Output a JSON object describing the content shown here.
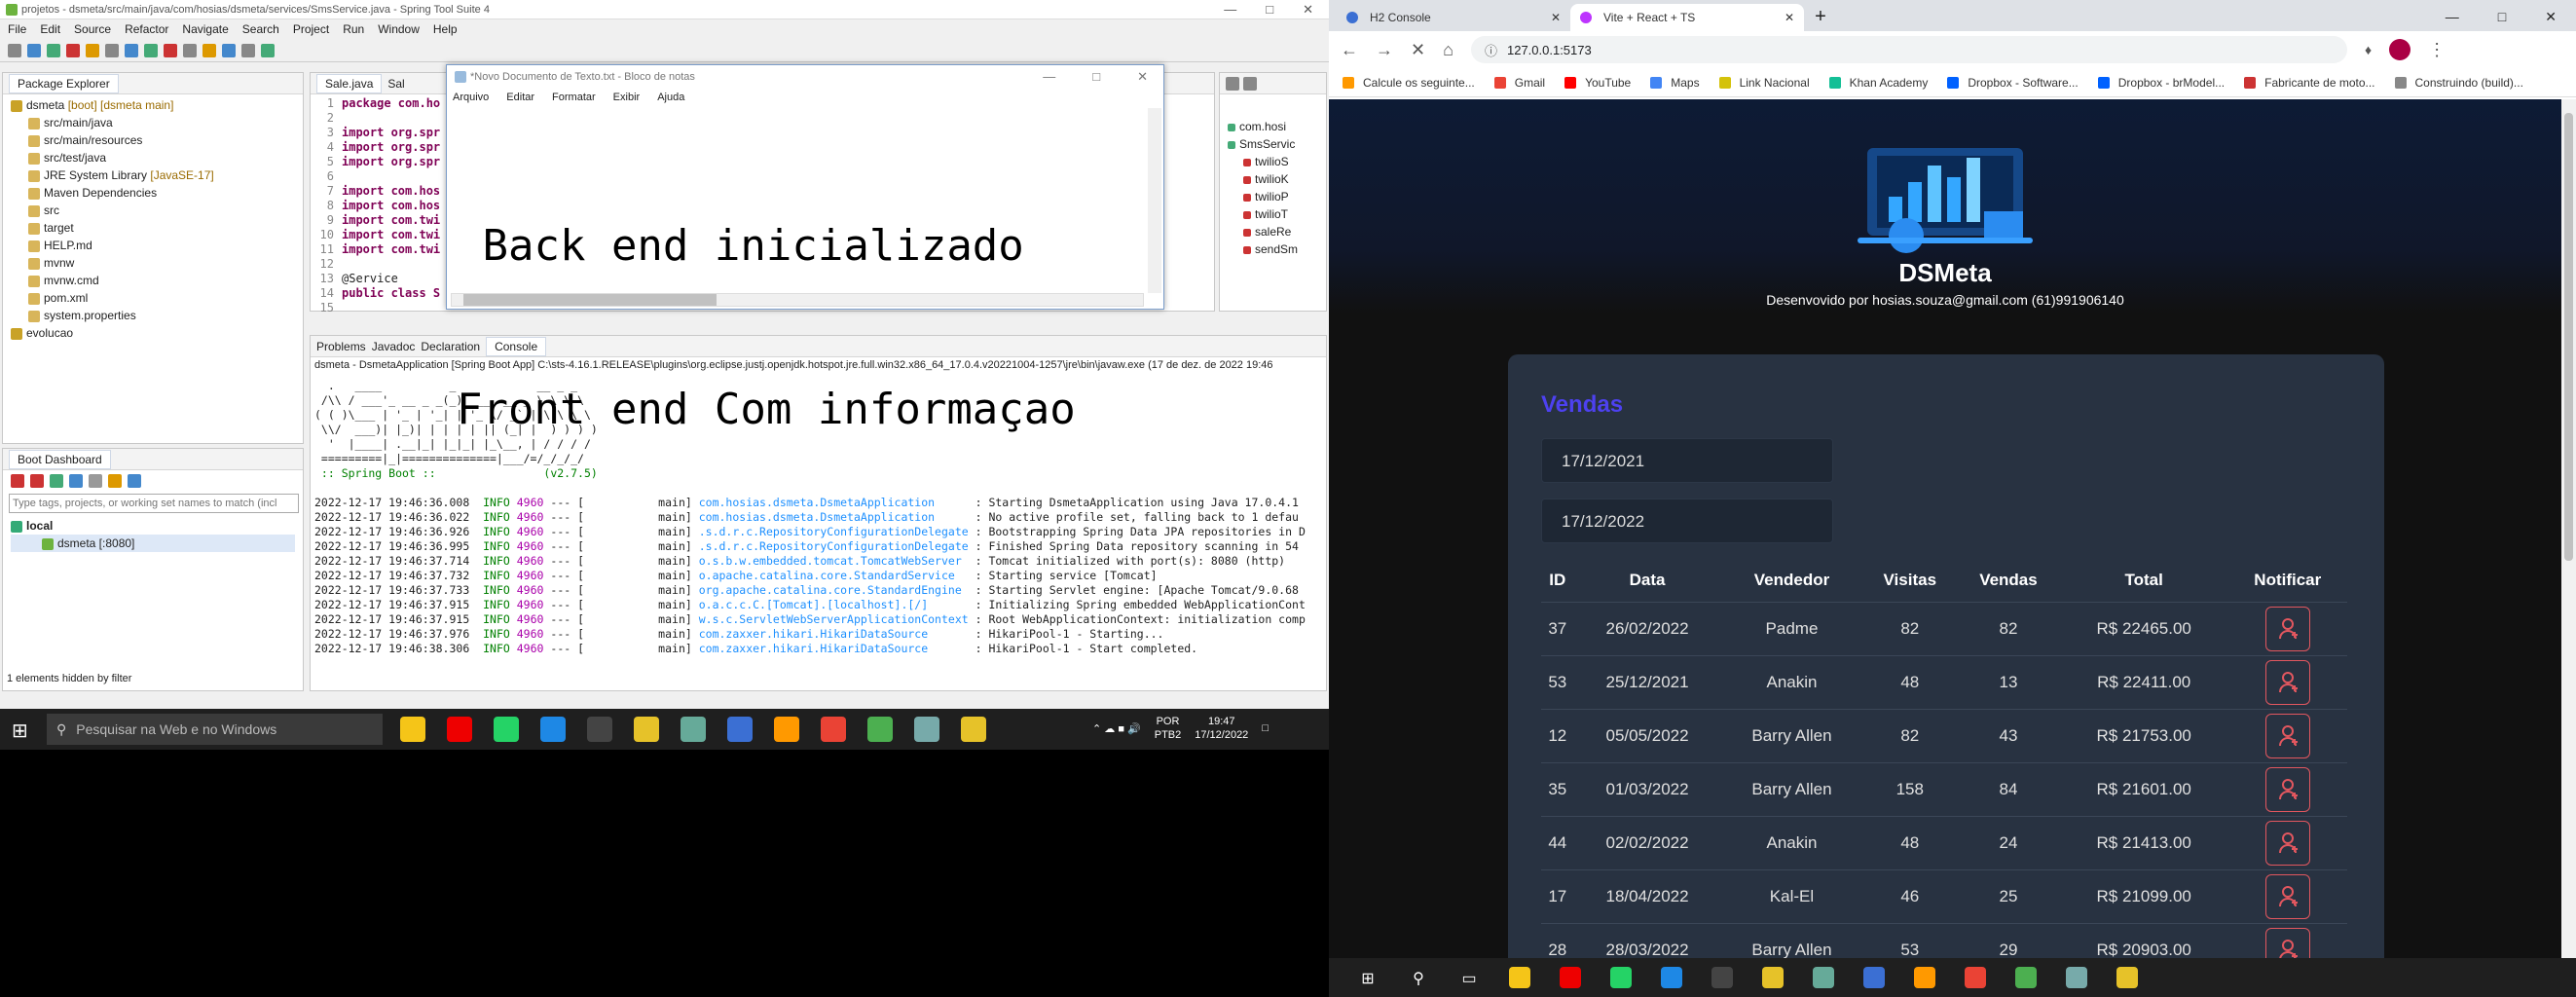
{
  "ide": {
    "title": "projetos - dsmeta/src/main/java/com/hosias/dsmeta/services/SmsService.java - Spring Tool Suite 4",
    "menu": [
      "File",
      "Edit",
      "Source",
      "Refactor",
      "Navigate",
      "Search",
      "Project",
      "Run",
      "Window",
      "Help"
    ],
    "package_explorer": {
      "tab": "Package Explorer",
      "items": [
        {
          "label": "dsmeta",
          "extra": " [boot] [dsmeta main]",
          "level": 0
        },
        {
          "label": "src/main/java",
          "level": 1
        },
        {
          "label": "src/main/resources",
          "level": 1
        },
        {
          "label": "src/test/java",
          "level": 1
        },
        {
          "label": "JRE System Library",
          "extra": " [JavaSE-17]",
          "level": 1
        },
        {
          "label": "Maven Dependencies",
          "level": 1
        },
        {
          "label": "src",
          "level": 1
        },
        {
          "label": "target",
          "level": 1
        },
        {
          "label": "HELP.md",
          "level": 1
        },
        {
          "label": "mvnw",
          "level": 1
        },
        {
          "label": "mvnw.cmd",
          "level": 1
        },
        {
          "label": "pom.xml",
          "level": 1
        },
        {
          "label": "system.properties",
          "level": 1
        },
        {
          "label": "evolucao",
          "level": 0
        }
      ]
    },
    "editor_tabs": [
      "Sale.java",
      "Sal"
    ],
    "code": [
      {
        "n": "1",
        "t": "package com.ho"
      },
      {
        "n": "2",
        "t": ""
      },
      {
        "n": "3",
        "t": "import org.spr"
      },
      {
        "n": "4",
        "t": "import org.spr"
      },
      {
        "n": "5",
        "t": "import org.spr"
      },
      {
        "n": "6",
        "t": ""
      },
      {
        "n": "7",
        "t": "import com.hos"
      },
      {
        "n": "8",
        "t": "import com.hos"
      },
      {
        "n": "9",
        "t": "import com.twi"
      },
      {
        "n": "10",
        "t": "import com.twi"
      },
      {
        "n": "11",
        "t": "import com.twi"
      },
      {
        "n": "12",
        "t": ""
      },
      {
        "n": "13",
        "t": "@Service"
      },
      {
        "n": "14",
        "t": "public class S"
      },
      {
        "n": "15",
        "t": ""
      }
    ],
    "outline": [
      "com.hosi",
      "SmsServic",
      "twilioS",
      "twilioK",
      "twilioP",
      "twilioT",
      "saleRe",
      "sendSm"
    ],
    "boot_dashboard": {
      "tab": "Boot Dashboard",
      "filter_placeholder": "Type tags, projects, or working set names to match (incl",
      "local": "local",
      "app": "dsmeta [:8080]",
      "footer": "1 elements hidden by filter"
    },
    "console_tabs": [
      "Problems",
      "Javadoc",
      "Declaration",
      "Console"
    ],
    "console_header": "dsmeta - DsmetaApplication [Spring Boot App] C:\\sts-4.16.1.RELEASE\\plugins\\org.eclipse.justj.openjdk.hotspot.jre.full.win32.x86_64_17.0.4.v20221004-1257\\jre\\bin\\javaw.exe  (17 de dez. de 2022 19:46",
    "banner": [
      "  .   ____          _            __ _ _",
      " /\\\\ / ___'_ __ _ _(_)_ __  __ _ \\ \\ \\ \\",
      "( ( )\\___ | '_ | '_| | '_ \\/ _` | \\ \\ \\ \\",
      " \\\\/  ___)| |_)| | | | | || (_| |  ) ) ) )",
      "  '  |____| .__|_| |_|_| |_\\__, | / / / /",
      " =========|_|==============|___/=/_/_/_/"
    ],
    "spring_boot": " :: Spring Boot ::                (v2.7.5)",
    "logs": [
      {
        "ts": "2022-12-17 19:46:36.008",
        "lvl": "INFO",
        "pid": "4960",
        "thr": "--- [           main]",
        "cls": "com.hosias.dsmeta.DsmetaApplication     ",
        "msg": " : Starting DsmetaApplication using Java 17.0.4.1"
      },
      {
        "ts": "2022-12-17 19:46:36.022",
        "lvl": "INFO",
        "pid": "4960",
        "thr": "--- [           main]",
        "cls": "com.hosias.dsmeta.DsmetaApplication     ",
        "msg": " : No active profile set, falling back to 1 defau"
      },
      {
        "ts": "2022-12-17 19:46:36.926",
        "lvl": "INFO",
        "pid": "4960",
        "thr": "--- [           main]",
        "cls": ".s.d.r.c.RepositoryConfigurationDelegate",
        "msg": " : Bootstrapping Spring Data JPA repositories in D"
      },
      {
        "ts": "2022-12-17 19:46:36.995",
        "lvl": "INFO",
        "pid": "4960",
        "thr": "--- [           main]",
        "cls": ".s.d.r.c.RepositoryConfigurationDelegate",
        "msg": " : Finished Spring Data repository scanning in 54"
      },
      {
        "ts": "2022-12-17 19:46:37.714",
        "lvl": "INFO",
        "pid": "4960",
        "thr": "--- [           main]",
        "cls": "o.s.b.w.embedded.tomcat.TomcatWebServer ",
        "msg": " : Tomcat initialized with port(s): 8080 (http)"
      },
      {
        "ts": "2022-12-17 19:46:37.732",
        "lvl": "INFO",
        "pid": "4960",
        "thr": "--- [           main]",
        "cls": "o.apache.catalina.core.StandardService  ",
        "msg": " : Starting service [Tomcat]"
      },
      {
        "ts": "2022-12-17 19:46:37.733",
        "lvl": "INFO",
        "pid": "4960",
        "thr": "--- [           main]",
        "cls": "org.apache.catalina.core.StandardEngine ",
        "msg": " : Starting Servlet engine: [Apache Tomcat/9.0.68"
      },
      {
        "ts": "2022-12-17 19:46:37.915",
        "lvl": "INFO",
        "pid": "4960",
        "thr": "--- [           main]",
        "cls": "o.a.c.c.C.[Tomcat].[localhost].[/]      ",
        "msg": " : Initializing Spring embedded WebApplicationCont"
      },
      {
        "ts": "2022-12-17 19:46:37.915",
        "lvl": "INFO",
        "pid": "4960",
        "thr": "--- [           main]",
        "cls": "w.s.c.ServletWebServerApplicationContext",
        "msg": " : Root WebApplicationContext: initialization comp"
      },
      {
        "ts": "2022-12-17 19:46:37.976",
        "lvl": "INFO",
        "pid": "4960",
        "thr": "--- [           main]",
        "cls": "com.zaxxer.hikari.HikariDataSource      ",
        "msg": " : HikariPool-1 - Starting..."
      },
      {
        "ts": "2022-12-17 19:46:38.306",
        "lvl": "INFO",
        "pid": "4960",
        "thr": "--- [           main]",
        "cls": "com.zaxxer.hikari.HikariDataSource      ",
        "msg": " : HikariPool-1 - Start completed."
      }
    ]
  },
  "notepad": {
    "title": "*Novo Documento de Texto.txt - Bloco de notas",
    "menu": [
      "Arquivo",
      "Editar",
      "Formatar",
      "Exibir",
      "Ajuda"
    ],
    "line1": " Back end inicializado",
    "line2": "Front end Com informaçao"
  },
  "taskbar_left": {
    "search_placeholder": "Pesquisar na Web e no Windows",
    "lang1": "POR",
    "lang2": "PTB2",
    "time": "19:47",
    "date": "17/12/2022"
  },
  "browser": {
    "tabs": [
      {
        "label": "H2 Console"
      },
      {
        "label": "Vite + React + TS"
      }
    ],
    "url": "127.0.0.1:5173",
    "bookmarks": [
      "Calcule os seguinte...",
      "Gmail",
      "YouTube",
      "Maps",
      "Link Nacional",
      "Khan Academy",
      "Dropbox - Software...",
      "Dropbox - brModel...",
      "Fabricante de moto...",
      "Construindo (build)..."
    ],
    "site": {
      "title": "DSMeta",
      "subtitle": "Desenvovido por hosias.souza@gmail.com (61)991906140",
      "card_title": "Vendas",
      "date_min": "17/12/2021",
      "date_max": "17/12/2022",
      "columns": [
        "ID",
        "Data",
        "Vendedor",
        "Visitas",
        "Vendas",
        "Total",
        "Notificar"
      ],
      "rows": [
        {
          "id": "37",
          "data": "26/02/2022",
          "vendedor": "Padme",
          "visitas": "82",
          "vendas": "82",
          "total": "R$ 22465.00"
        },
        {
          "id": "53",
          "data": "25/12/2021",
          "vendedor": "Anakin",
          "visitas": "48",
          "vendas": "13",
          "total": "R$ 22411.00"
        },
        {
          "id": "12",
          "data": "05/05/2022",
          "vendedor": "Barry Allen",
          "visitas": "82",
          "vendas": "43",
          "total": "R$ 21753.00"
        },
        {
          "id": "35",
          "data": "01/03/2022",
          "vendedor": "Barry Allen",
          "visitas": "158",
          "vendas": "84",
          "total": "R$ 21601.00"
        },
        {
          "id": "44",
          "data": "02/02/2022",
          "vendedor": "Anakin",
          "visitas": "48",
          "vendas": "24",
          "total": "R$ 21413.00"
        },
        {
          "id": "17",
          "data": "18/04/2022",
          "vendedor": "Kal-El",
          "visitas": "46",
          "vendas": "25",
          "total": "R$ 21099.00"
        },
        {
          "id": "28",
          "data": "28/03/2022",
          "vendedor": "Barry Allen",
          "visitas": "53",
          "vendas": "29",
          "total": "R$ 20903.00"
        }
      ]
    }
  },
  "colors": {
    "accent": "#4d41f0",
    "notify": "#e2575f",
    "card": "#283241",
    "page": "#111111"
  }
}
